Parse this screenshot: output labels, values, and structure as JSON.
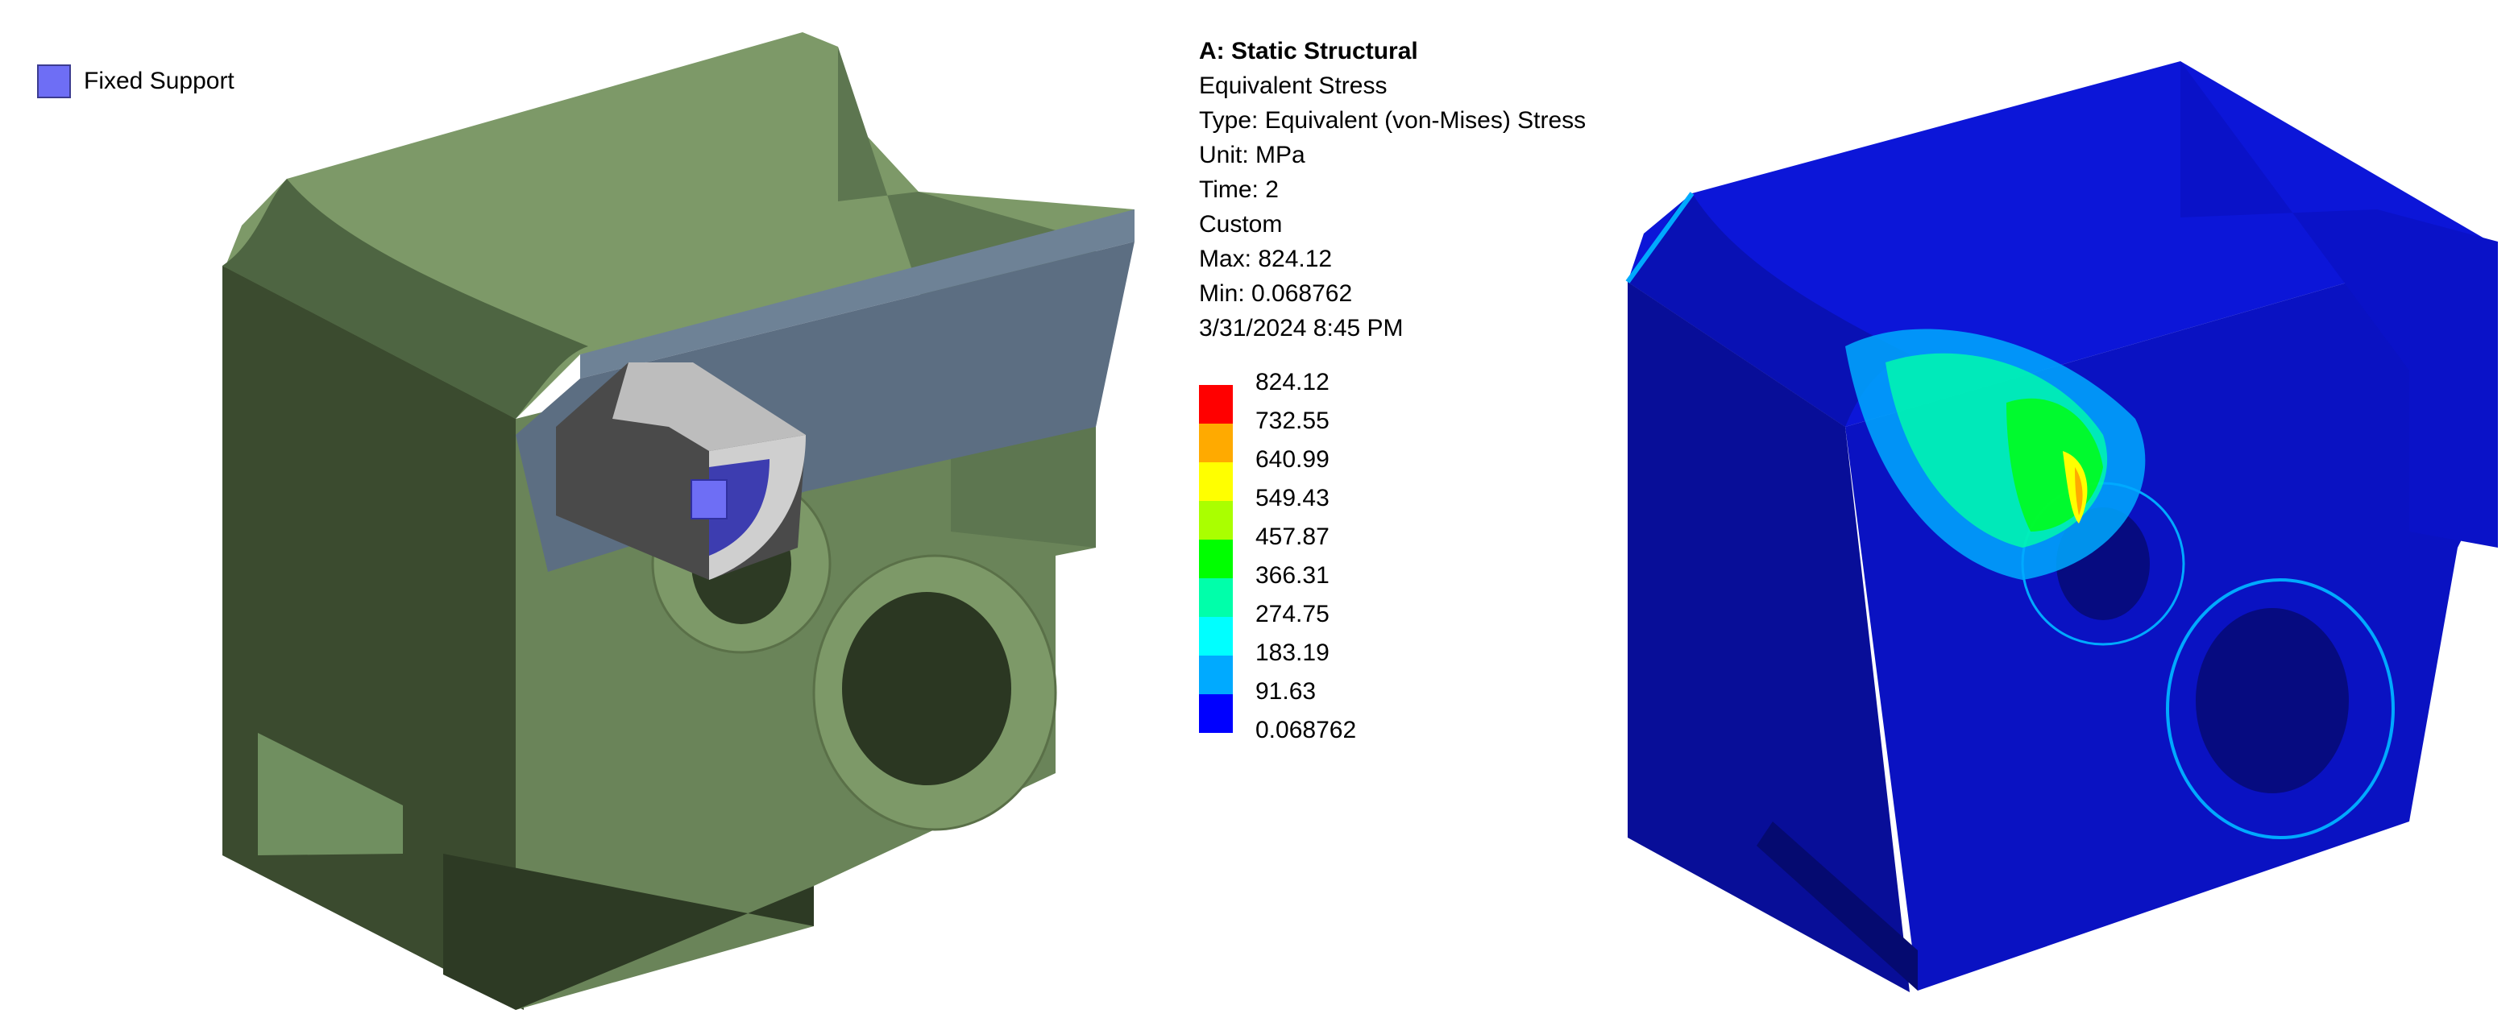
{
  "legend": {
    "label": "Fixed Support",
    "color": "#6e6ef5"
  },
  "result": {
    "title": "A: Static Structural",
    "name": "Equivalent Stress",
    "type": "Type: Equivalent (von-Mises) Stress",
    "unit": "Unit: MPa",
    "time": "Time: 2",
    "mode": "Custom",
    "max": "Max: 824.12",
    "min": "Min: 0.068762",
    "date": "3/31/2024 8:45 PM"
  },
  "scale": {
    "labels": [
      "824.12",
      "732.55",
      "640.99",
      "549.43",
      "457.87",
      "366.31",
      "274.75",
      "183.19",
      "91.63",
      "0.068762"
    ],
    "colors": [
      "#ff0000",
      "#ffaa00",
      "#ffff00",
      "#aaff00",
      "#00ff00",
      "#00ffaa",
      "#00ffff",
      "#00aaff",
      "#0000ff"
    ]
  },
  "models": {
    "left_color": "#6a8459",
    "right_color": "#0a10b8"
  }
}
